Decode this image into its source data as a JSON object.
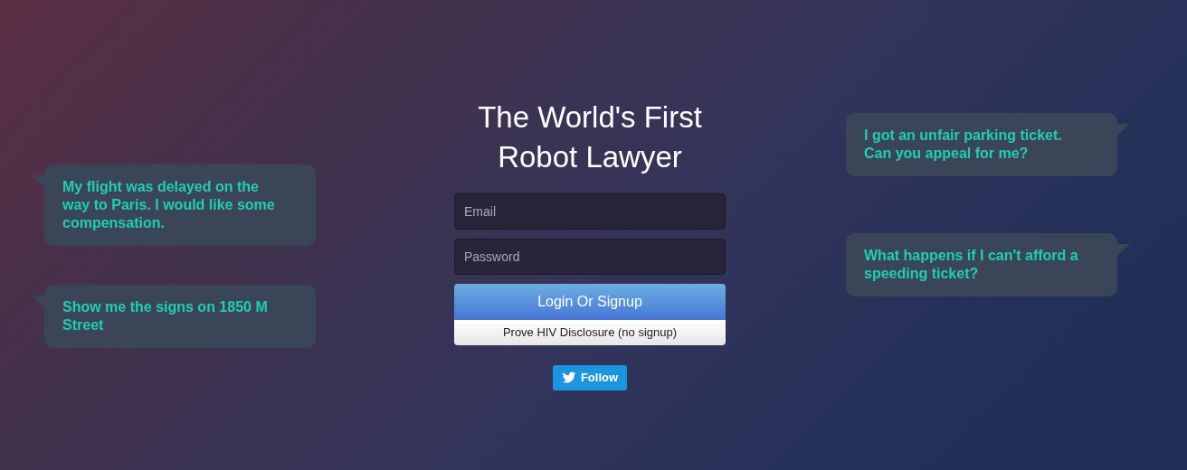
{
  "title_lines": [
    "The World's First",
    "Robot Lawyer"
  ],
  "left_bubbles": [
    {
      "text": "My flight was delayed on the way to Paris. I would like some compensation."
    },
    {
      "text": "Show me the signs on 1850 M Street"
    }
  ],
  "right_bubbles": [
    {
      "text": "I got an unfair parking ticket. Can you appeal for me?"
    },
    {
      "text": "What happens if I can't afford a speeding ticket?"
    }
  ],
  "email": {
    "placeholder": "Email"
  },
  "password": {
    "placeholder": "Password"
  },
  "login_button": "Login Or Signup",
  "secondary_button": "Prove HIV Disclosure (no signup)",
  "follow_button": "Follow"
}
